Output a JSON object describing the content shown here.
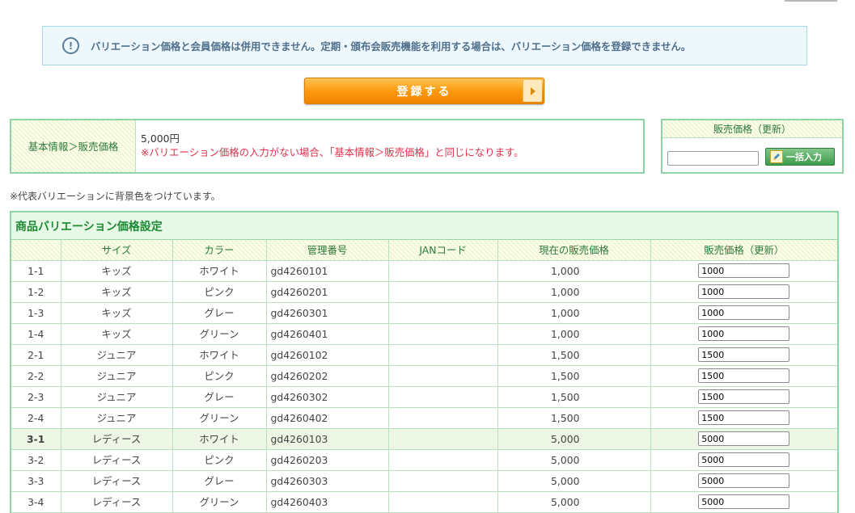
{
  "notice": {
    "text": "バリエーション価格と会員価格は併用できません。定期・頒布会販売機能を利用する場合は、バリエーション価格を登録できません。"
  },
  "register_button": {
    "label": "登録する"
  },
  "base_price": {
    "label": "基本情報＞販売価格",
    "value": "5,000円",
    "note": "※バリエーション価格の入力がない場合、「基本情報＞販売価格」と同じになります。"
  },
  "bulk": {
    "header": "販売価格（更新）",
    "input_value": "",
    "button_label": "一括入力"
  },
  "representative_note": "※代表バリエーションに背景色をつけています。",
  "variation_table": {
    "title": "商品バリエーション価格設定",
    "headers": [
      "",
      "サイズ",
      "カラー",
      "管理番号",
      "JANコード",
      "現在の販売価格",
      "販売価格（更新）"
    ],
    "rows": [
      {
        "num": "1-1",
        "size": "キッズ",
        "color": "ホワイト",
        "code": "gd4260101",
        "jan": "",
        "current": "1,000",
        "input": "1000"
      },
      {
        "num": "1-2",
        "size": "キッズ",
        "color": "ピンク",
        "code": "gd4260201",
        "jan": "",
        "current": "1,000",
        "input": "1000"
      },
      {
        "num": "1-3",
        "size": "キッズ",
        "color": "グレー",
        "code": "gd4260301",
        "jan": "",
        "current": "1,000",
        "input": "1000"
      },
      {
        "num": "1-4",
        "size": "キッズ",
        "color": "グリーン",
        "code": "gd4260401",
        "jan": "",
        "current": "1,000",
        "input": "1000"
      },
      {
        "num": "2-1",
        "size": "ジュニア",
        "color": "ホワイト",
        "code": "gd4260102",
        "jan": "",
        "current": "1,500",
        "input": "1500"
      },
      {
        "num": "2-2",
        "size": "ジュニア",
        "color": "ピンク",
        "code": "gd4260202",
        "jan": "",
        "current": "1,500",
        "input": "1500"
      },
      {
        "num": "2-3",
        "size": "ジュニア",
        "color": "グレー",
        "code": "gd4260302",
        "jan": "",
        "current": "1,500",
        "input": "1500"
      },
      {
        "num": "2-4",
        "size": "ジュニア",
        "color": "グリーン",
        "code": "gd4260402",
        "jan": "",
        "current": "1,500",
        "input": "1500"
      },
      {
        "num": "3-1",
        "size": "レディース",
        "color": "ホワイト",
        "code": "gd4260103",
        "jan": "",
        "current": "5,000",
        "input": "5000",
        "representative": true
      },
      {
        "num": "3-2",
        "size": "レディース",
        "color": "ピンク",
        "code": "gd4260203",
        "jan": "",
        "current": "5,000",
        "input": "5000"
      },
      {
        "num": "3-3",
        "size": "レディース",
        "color": "グレー",
        "code": "gd4260303",
        "jan": "",
        "current": "5,000",
        "input": "5000"
      },
      {
        "num": "3-4",
        "size": "レディース",
        "color": "グリーン",
        "code": "gd4260403",
        "jan": "",
        "current": "5,000",
        "input": "5000"
      }
    ]
  },
  "colors": {
    "accent_green": "#1e8a33",
    "border_green": "#8fd4a4",
    "note_red": "#e0314b",
    "button_orange": "#fb9a10",
    "representative_row_bg": "#eef6e5"
  }
}
